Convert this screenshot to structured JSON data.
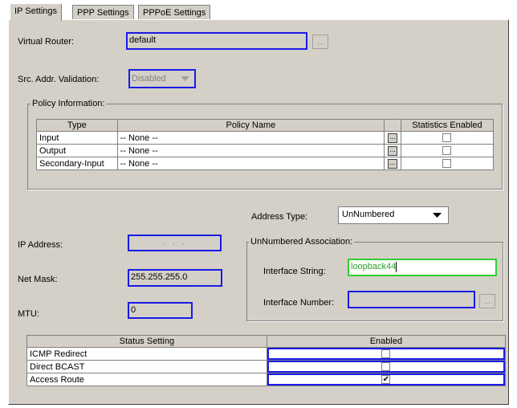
{
  "tabs": [
    {
      "label": "IP Settings",
      "active": true
    },
    {
      "label": "PPP Settings",
      "active": false
    },
    {
      "label": "PPPoE Settings",
      "active": false
    }
  ],
  "virtual_router": {
    "label": "Virtual Router:",
    "value": "default",
    "browse_label": "..."
  },
  "src_addr": {
    "label": "Src. Addr. Validation:",
    "value": "Disabled",
    "arrow": "chevron-down"
  },
  "policy": {
    "title": "Policy Information:",
    "columns": [
      "Type",
      "Policy Name",
      "",
      "Statistics Enabled"
    ],
    "rows": [
      {
        "type": "Input",
        "name": "-- None --",
        "btn": "...",
        "checked": false
      },
      {
        "type": "Output",
        "name": "-- None --",
        "btn": "...",
        "checked": false
      },
      {
        "type": "Secondary-Input",
        "name": "-- None --",
        "btn": "...",
        "checked": false
      }
    ]
  },
  "address_type": {
    "label": "Address Type:",
    "value": "UnNumbered"
  },
  "ip_address": {
    "label": "IP Address:",
    "value": ". . ."
  },
  "net_mask": {
    "label": "Net Mask:",
    "value": "255.255.255.0"
  },
  "mtu": {
    "label": "MTU:",
    "value": "0"
  },
  "unnumbered": {
    "title": "UnNumbered Association:",
    "interface_string_label": "Interface String:",
    "interface_string_value": "loopback44",
    "interface_number_label": "Interface Number:",
    "interface_number_value": "",
    "browse_label": "..."
  },
  "status": {
    "columns": [
      "Status Setting",
      "Enabled"
    ],
    "rows": [
      {
        "name": "ICMP Redirect",
        "mark": ""
      },
      {
        "name": "Direct BCAST",
        "mark": ""
      },
      {
        "name": "Access Route",
        "mark": "✔"
      }
    ]
  },
  "colors": {
    "panel": "#d4d0c8",
    "focus_border": "#1a1ae6",
    "active_field_border": "#33cc33",
    "field_text_green": "#2d9e2d"
  }
}
